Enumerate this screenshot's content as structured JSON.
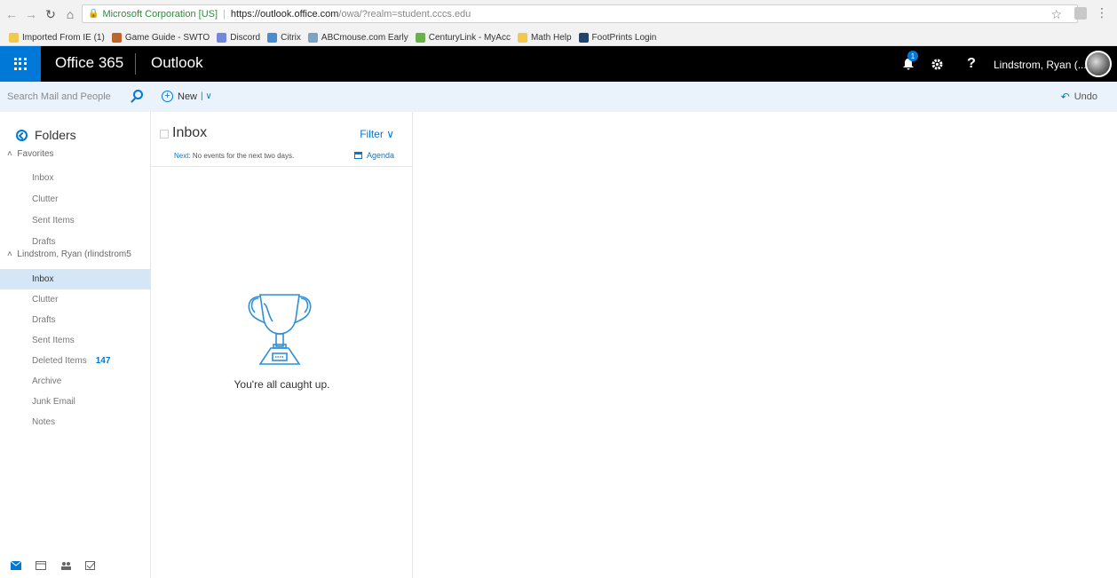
{
  "browser": {
    "site_name": "Microsoft Corporation [US]",
    "url_host": "https://outlook.office.com",
    "url_rest": "/owa/?realm=student.cccs.edu",
    "bookmarks": [
      {
        "label": "Imported From IE (1)",
        "color": "#f2c94c"
      },
      {
        "label": "Game Guide - SWTO",
        "color": "#c0642d"
      },
      {
        "label": "Discord",
        "color": "#7289da"
      },
      {
        "label": "Citrix",
        "color": "#4a8ccf"
      },
      {
        "label": "ABCmouse.com Early",
        "color": "#7aa3c6"
      },
      {
        "label": "CenturyLink - MyAcc",
        "color": "#6ab04c"
      },
      {
        "label": "Math Help",
        "color": "#f2c94c"
      },
      {
        "label": "FootPrints Login",
        "color": "#22436e"
      }
    ]
  },
  "topbar": {
    "brand": "Office 365",
    "app": "Outlook",
    "notification_count": "1",
    "help": "?",
    "username": "Lindstrom, Ryan (..."
  },
  "commandbar": {
    "search_placeholder": "Search Mail and People",
    "new_label": "New",
    "undo_label": "Undo"
  },
  "folders": {
    "header": "Folders",
    "favorites_label": "Favorites",
    "favorites": [
      "Inbox",
      "Clutter",
      "Sent Items",
      "Drafts"
    ],
    "account_label": "Lindstrom, Ryan (rlindstrom5",
    "account_folders": [
      {
        "label": "Inbox",
        "count": "",
        "selected": true
      },
      {
        "label": "Clutter",
        "count": ""
      },
      {
        "label": "Drafts",
        "count": ""
      },
      {
        "label": "Sent Items",
        "count": ""
      },
      {
        "label": "Deleted Items",
        "count": "147"
      },
      {
        "label": "Archive",
        "count": ""
      },
      {
        "label": "Junk Email",
        "count": ""
      },
      {
        "label": "Notes",
        "count": ""
      }
    ]
  },
  "messagelist": {
    "title": "Inbox",
    "filter_label": "Filter",
    "next_label": "Next:",
    "next_text": "No events for the next two days.",
    "agenda_label": "Agenda",
    "empty_text": "You're all caught up."
  },
  "colors": {
    "accent": "#0078d7",
    "selected": "#d5e7f7"
  }
}
